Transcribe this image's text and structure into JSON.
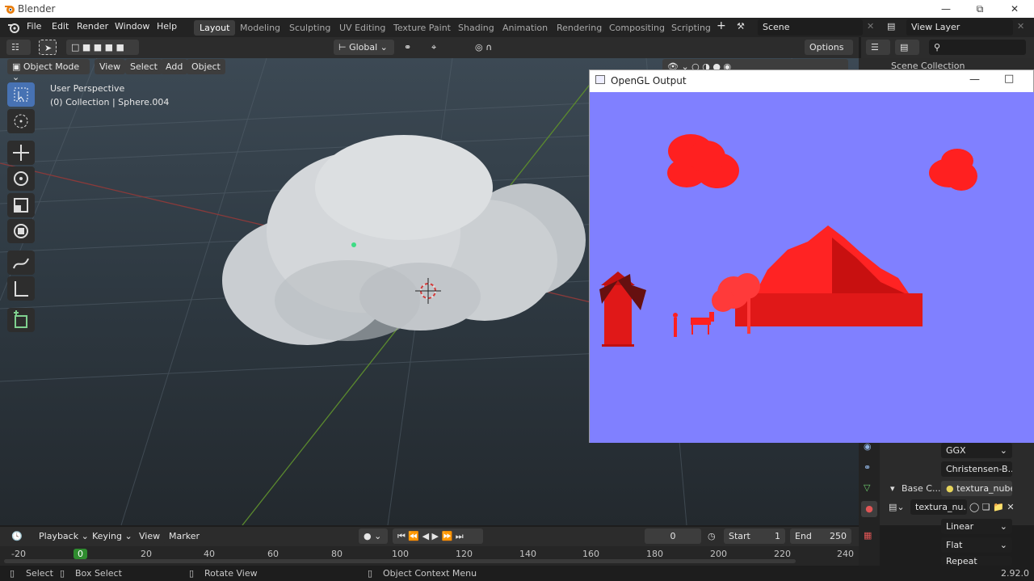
{
  "app": {
    "title": "Blender",
    "version": "2.92.0"
  },
  "menu": [
    "File",
    "Edit",
    "Render",
    "Window",
    "Help"
  ],
  "workspaces": [
    {
      "label": "Layout",
      "active": true
    },
    {
      "label": "Modeling"
    },
    {
      "label": "Sculpting"
    },
    {
      "label": "UV Editing"
    },
    {
      "label": "Texture Paint"
    },
    {
      "label": "Shading"
    },
    {
      "label": "Animation"
    },
    {
      "label": "Rendering"
    },
    {
      "label": "Compositing"
    },
    {
      "label": "Scripting"
    }
  ],
  "scene": {
    "label": "Scene",
    "view_layer": "View Layer"
  },
  "header": {
    "mode": "Object Mode",
    "menus": [
      "View",
      "Select",
      "Add",
      "Object"
    ],
    "orientation": "Global",
    "options": "Options"
  },
  "viewport": {
    "perspective": "User Perspective",
    "collection": "(0) Collection | Sphere.004"
  },
  "outliner": {
    "title": "Scene Collection"
  },
  "gl_window": {
    "title": "OpenGL Output"
  },
  "properties": {
    "distribution": "GGX",
    "subsurface": "Christensen-B...",
    "base_color_label": "Base C...",
    "texture_name": "textura_nube...",
    "image_name": "textura_nu...",
    "interpolation": "Linear",
    "projection": "Flat",
    "extension": "Repeat"
  },
  "timeline": {
    "menus": [
      "Playback",
      "Keying",
      "View",
      "Marker"
    ],
    "current_frame": "0",
    "start_label": "Start",
    "start": "1",
    "end_label": "End",
    "end": "250",
    "ticks": [
      "-20",
      "0",
      "20",
      "40",
      "60",
      "80",
      "100",
      "120",
      "140",
      "160",
      "180",
      "200",
      "220",
      "240"
    ]
  },
  "status": {
    "select": "Select",
    "box_select": "Box Select",
    "rotate": "Rotate View",
    "context_menu": "Object Context Menu"
  },
  "colors": {
    "accent": "#4772b3",
    "gl_bg": "#8080ff",
    "gl_objects": "#ff2020",
    "frame_indicator": "#2f8c2f"
  }
}
